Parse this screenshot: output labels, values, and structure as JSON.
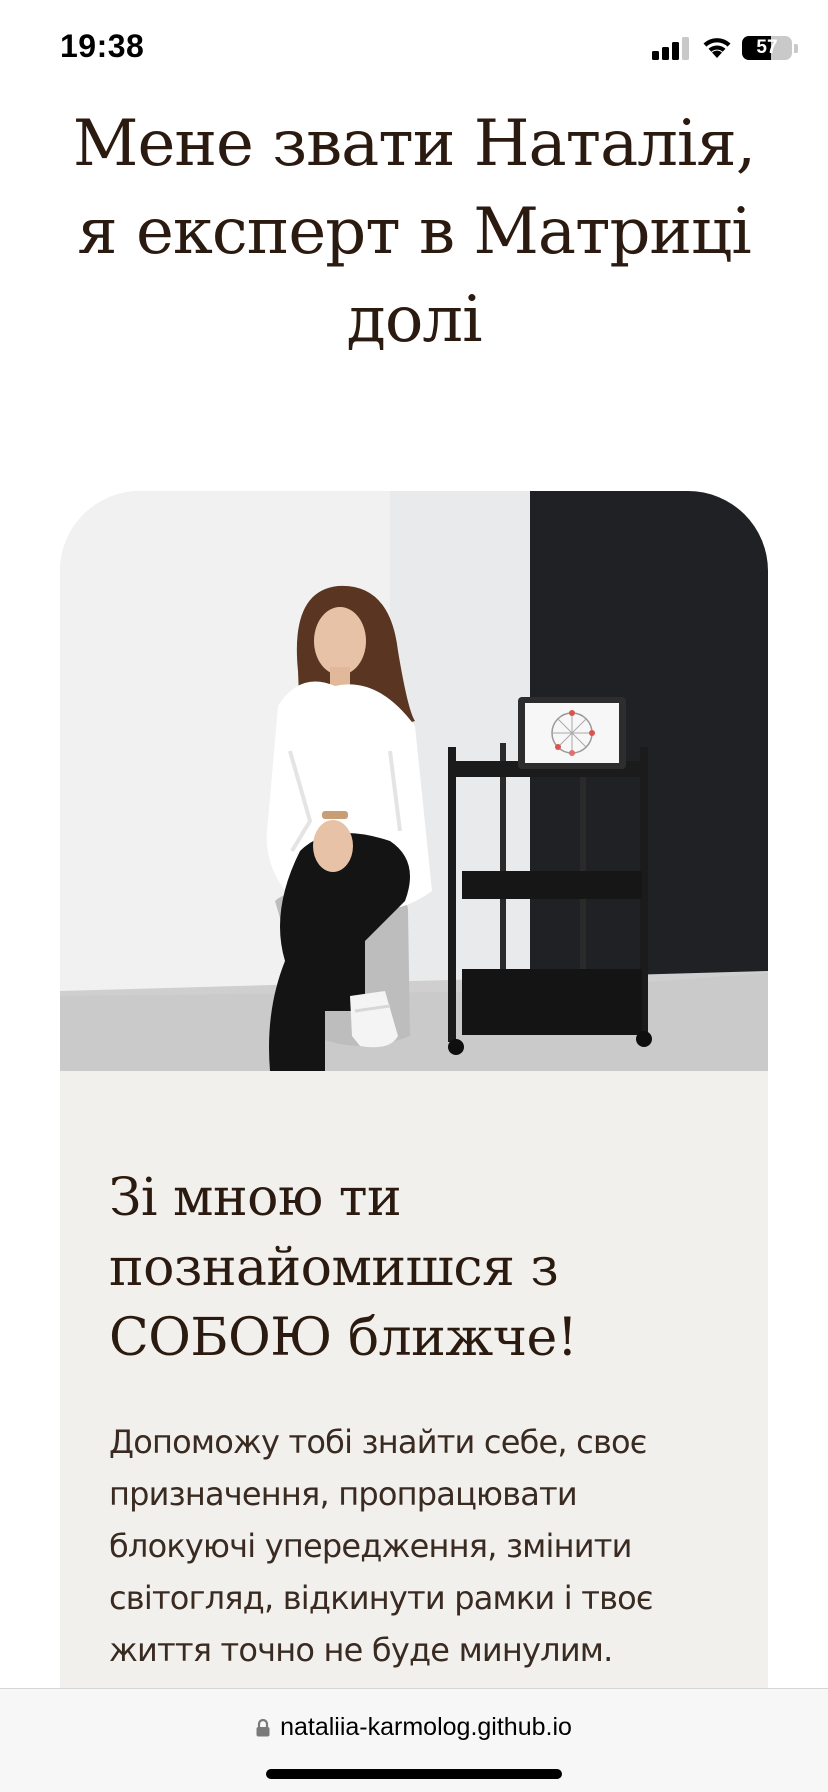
{
  "status_bar": {
    "time": "19:38",
    "battery_level": "57",
    "battery_fraction": 0.57,
    "icons": [
      "cellular-signal-icon",
      "wifi-icon",
      "battery-icon"
    ]
  },
  "hero": {
    "headline": "Мене звати Наталія, я експерт в Матриці долі"
  },
  "card": {
    "photo_icon": "portrait-photo",
    "title": "Зі мною ти познайомишся з СОБОЮ ближче!",
    "text": "Допоможу тобі знайти себе, своє призначення, пропрацювати блокуючі упередження, змінити світогляд, відкинути рамки і твоє життя точно не буде минулим."
  },
  "browser": {
    "url": "nataliia-karmolog.github.io",
    "lock_icon": "lock-icon"
  },
  "colors": {
    "text_dark": "#2b1a0f",
    "card_background": "#f2f0ec",
    "page_background": "#ffffff",
    "dark_wall": "#202124"
  }
}
